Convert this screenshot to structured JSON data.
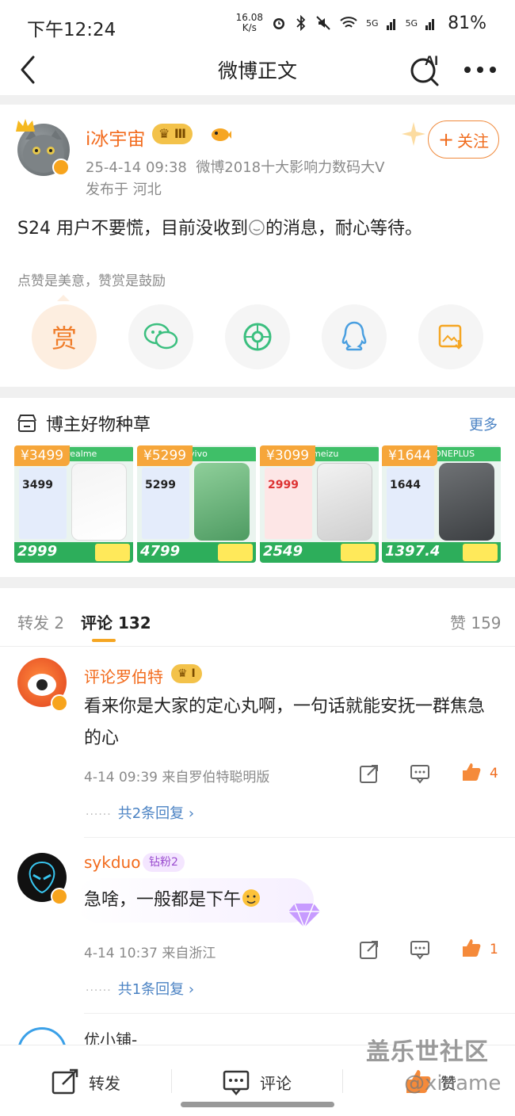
{
  "status_bar": {
    "time": "下午12:24",
    "net_speed_value": "16.08",
    "net_speed_unit": "K/s",
    "signal_1": "5G",
    "signal_2": "5G",
    "battery": "81%"
  },
  "header": {
    "title": "微博正文",
    "ai_label": "AI"
  },
  "post": {
    "author": "i冰宇宙",
    "level": "Ⅲ",
    "time": "25-4-14 09:38",
    "author_desc": "微博2018十大影响力数码大V",
    "location": "发布于 河北",
    "follow_label": "关注",
    "text_before": "S24 用户不要慌，目前没收到",
    "text_after": "的消息，耐心等待。",
    "reward_hint": "点赞是美意，赞赏是鼓励",
    "reward_label": "赏"
  },
  "goods": {
    "title": "博主好物种草",
    "more": "更多",
    "items": [
      {
        "price": "¥3499",
        "brand": "realme",
        "card_price": "3499",
        "bottom_price": "2999"
      },
      {
        "price": "¥5299",
        "brand": "vivo",
        "card_price": "5299",
        "bottom_price": "4799"
      },
      {
        "price": "¥3099",
        "brand": "meizu",
        "card_price": "2999",
        "bottom_price": "2549"
      },
      {
        "price": "¥1644",
        "brand": "ONEPLUS",
        "card_price": "1644",
        "bottom_price": "1397.4"
      }
    ]
  },
  "tabs": {
    "repost": "转发 2",
    "comments": "评论 132",
    "likes": "赞 159"
  },
  "comments": [
    {
      "name": "评论罗伯特",
      "badge": "Ⅰ",
      "text": "看来你是大家的定心丸啊，一句话就能安抚一群焦急的心",
      "time_source": "4-14 09:39  来自罗伯特聪明版",
      "likes": "4",
      "replies": "共2条回复"
    },
    {
      "name": "sykduo",
      "badge": "钻粉2",
      "text": "急啥，一般都是下午",
      "time_source": "4-14 10:37  来自浙江",
      "likes": "1",
      "replies": "共1条回复"
    },
    {
      "name": "优小铺-"
    }
  ],
  "bottom_bar": {
    "repost": "转发",
    "comment": "评论",
    "like": "赞"
  },
  "watermark": {
    "line1": "盖乐世社区",
    "line2": "@xiname"
  },
  "colors": {
    "accent_orange": "#f26b1d",
    "link_blue": "#4a82c3",
    "tab_underline": "#f5a623"
  }
}
